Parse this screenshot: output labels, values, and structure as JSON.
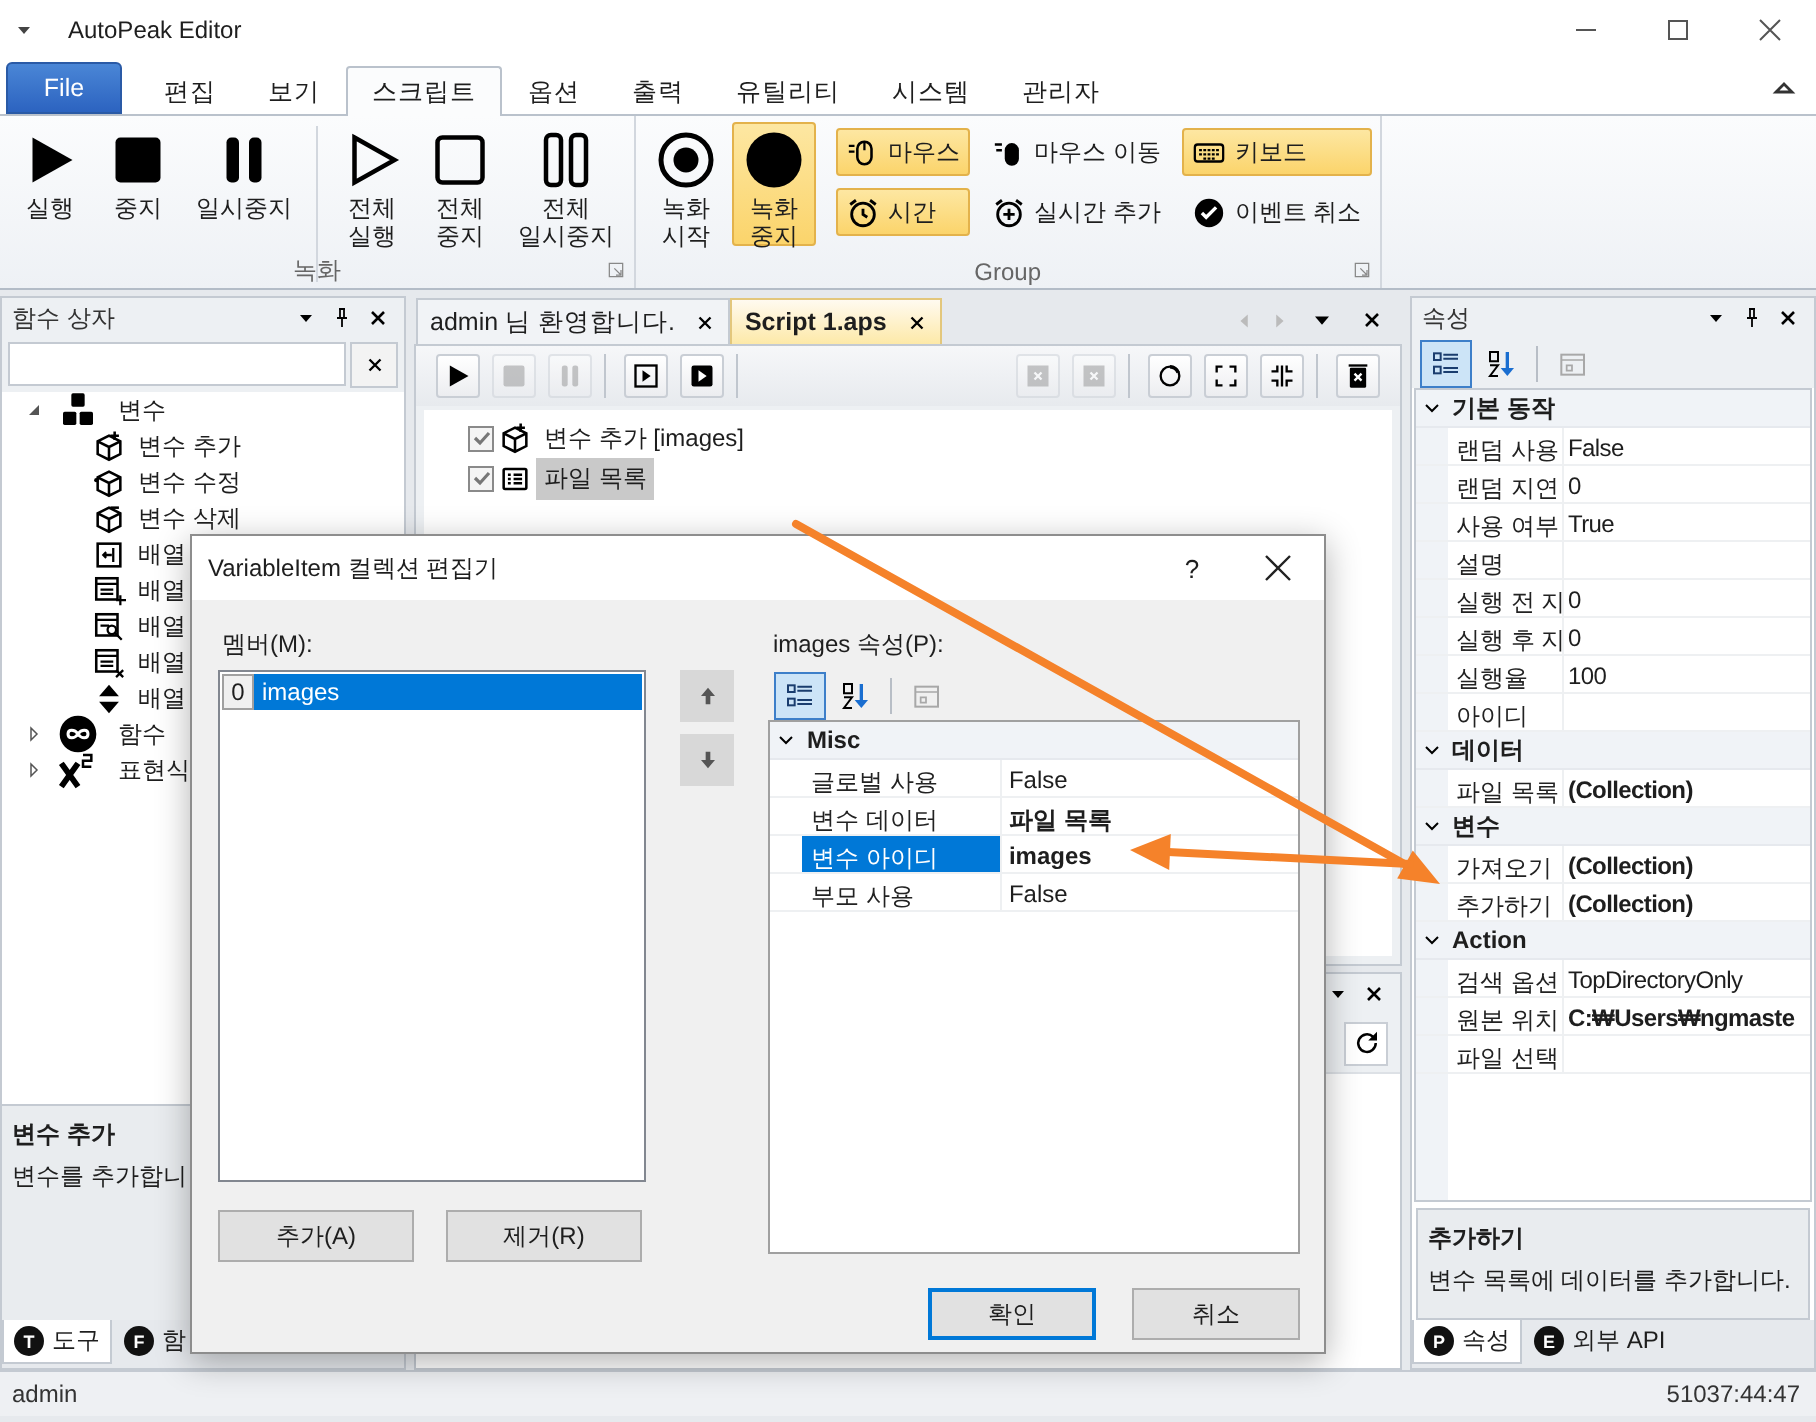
{
  "window": {
    "title": "AutoPeak Editor"
  },
  "ribbon": {
    "tabs": [
      {
        "label": "File",
        "kind": "file",
        "selected": false
      },
      {
        "label": "편집",
        "kind": "tab",
        "selected": false
      },
      {
        "label": "보기",
        "kind": "tab",
        "selected": false
      },
      {
        "label": "스크립트",
        "kind": "tab",
        "selected": true
      },
      {
        "label": "옵션",
        "kind": "tab",
        "selected": false
      },
      {
        "label": "출력",
        "kind": "tab",
        "selected": false
      },
      {
        "label": "유틸리티",
        "kind": "tab",
        "selected": false
      },
      {
        "label": "시스템",
        "kind": "tab",
        "selected": false
      },
      {
        "label": "관리자",
        "kind": "tab",
        "selected": false
      }
    ],
    "groups": [
      {
        "label": "녹화",
        "button_sets": [
          [
            {
              "label": "실행",
              "kind": "play",
              "active": false
            },
            {
              "label": "중지",
              "kind": "stop",
              "active": false
            },
            {
              "label": "일시중지",
              "kind": "pause",
              "active": false
            }
          ],
          [
            {
              "label": "전체 실행",
              "kind": "play-outline",
              "active": false
            },
            {
              "label": "전체 중지",
              "kind": "stop-outline",
              "active": false
            },
            {
              "label": "전체 일시중지",
              "kind": "pause-outline",
              "active": false
            }
          ]
        ]
      },
      {
        "label": "Group",
        "button_sets": [
          [
            {
              "label": "녹화 시작",
              "kind": "record",
              "active": false
            },
            {
              "label": "녹화 중지",
              "kind": "dot",
              "active": true
            }
          ]
        ],
        "small_buttons": [
          {
            "label": "마우스",
            "kind": "mouse",
            "active": true
          },
          {
            "label": "마우스 이동",
            "kind": "mouse-move",
            "active": false
          },
          {
            "label": "키보드",
            "kind": "keyboard",
            "active": true
          },
          {
            "label": "시간",
            "kind": "alarm",
            "active": true
          },
          {
            "label": "실시간 추가",
            "kind": "alarm-add",
            "active": false
          },
          {
            "label": "이벤트 취소",
            "kind": "check",
            "active": false
          }
        ]
      }
    ]
  },
  "function_box": {
    "title": "함수 상자",
    "tree": [
      {
        "label": "변수",
        "kind": "blocks",
        "expanded": true,
        "children": [
          {
            "label": "변수 추가",
            "kind": "box-add"
          },
          {
            "label": "변수 수정",
            "kind": "box-edit"
          },
          {
            "label": "변수 삭제",
            "kind": "box-remove"
          },
          {
            "label": "배열",
            "kind": "table-insert"
          },
          {
            "label": "배열",
            "kind": "table-add"
          },
          {
            "label": "배열",
            "kind": "table-search"
          },
          {
            "label": "배열",
            "kind": "table-remove"
          },
          {
            "label": "배열",
            "kind": "sort"
          }
        ]
      },
      {
        "label": "함수",
        "kind": "infinity",
        "expanded": false
      },
      {
        "label": "표현식",
        "kind": "x-squared",
        "expanded": false
      }
    ],
    "description": {
      "title": "변수 추가",
      "text": "변수를 추가합니"
    },
    "tabs": [
      {
        "badge": "T",
        "label": "도구",
        "selected": true
      },
      {
        "badge": "F",
        "label": "함",
        "selected": false
      }
    ]
  },
  "document": {
    "tabs": [
      {
        "label": "admin 님 환영합니다.",
        "selected": false
      },
      {
        "label": "Script 1.aps",
        "selected": true
      }
    ],
    "toolbar_left": [
      [
        {
          "kind": "play",
          "disabled": false
        },
        {
          "kind": "stop",
          "disabled": true
        },
        {
          "kind": "pause",
          "disabled": true
        }
      ],
      [
        {
          "kind": "play-frame",
          "disabled": false
        },
        {
          "kind": "play-box",
          "disabled": false
        }
      ]
    ],
    "toolbar_right": [
      [
        {
          "kind": "x-box",
          "disabled": true
        },
        {
          "kind": "x-box",
          "disabled": true
        }
      ],
      [
        {
          "kind": "circle",
          "disabled": false
        },
        {
          "kind": "expand",
          "disabled": false
        },
        {
          "kind": "collapse",
          "disabled": false
        }
      ],
      [
        {
          "kind": "delete",
          "disabled": false
        }
      ]
    ],
    "steps": [
      {
        "label": "변수 추가 [images]",
        "kind": "box-add",
        "checked": true,
        "selected": false
      },
      {
        "label": "파일 목록",
        "kind": "list",
        "checked": true,
        "selected": true
      }
    ],
    "lower_toolbar": [
      {
        "kind": "refresh",
        "disabled": false
      }
    ]
  },
  "properties": {
    "title": "속성",
    "toolbar": [
      {
        "kind": "categorized",
        "selected": true,
        "disabled": false
      },
      {
        "kind": "alphabetical",
        "selected": false,
        "disabled": false
      },
      {
        "kind": "pages",
        "selected": false,
        "disabled": true
      }
    ],
    "categories": [
      {
        "name": "기본 동작",
        "expanded": true,
        "rows": [
          {
            "name": "랜덤 사용",
            "value": "False",
            "bold": false
          },
          {
            "name": "랜덤 지연",
            "value": "0",
            "bold": false
          },
          {
            "name": "사용 여부",
            "value": "True",
            "bold": false
          },
          {
            "name": "설명"
          },
          {
            "name": "실행 전 지",
            "value": "0",
            "bold": false
          },
          {
            "name": "실행 후 지",
            "value": "0",
            "bold": false
          },
          {
            "name": "실행율",
            "value": "100",
            "bold": false
          },
          {
            "name": "아이디"
          }
        ]
      },
      {
        "name": "데이터",
        "expanded": true,
        "rows": [
          {
            "name": "파일 목록",
            "value": "(Collection)",
            "bold": true
          }
        ]
      },
      {
        "name": "변수",
        "expanded": true,
        "rows": [
          {
            "name": "가져오기",
            "value": "(Collection)",
            "bold": true
          },
          {
            "name": "추가하기",
            "value": "(Collection)",
            "bold": true
          }
        ]
      },
      {
        "name": "Action",
        "expanded": true,
        "rows": [
          {
            "name": "검색 옵션",
            "value": "TopDirectoryOnly",
            "bold": false
          },
          {
            "name": "원본 위치",
            "value": "C:₩Users₩ngmaste",
            "bold": true
          },
          {
            "name": "파일 선택"
          }
        ]
      }
    ],
    "description": {
      "title": "추가하기",
      "text": "변수 목록에 데이터를 추가합니다."
    },
    "tabs": [
      {
        "badge": "P",
        "label": "속성",
        "selected": true
      },
      {
        "badge": "E",
        "label": "외부 API",
        "selected": false
      }
    ]
  },
  "dialog": {
    "title": "VariableItem 컬렉션 편집기",
    "help": "?",
    "members_label": "멤버(M):",
    "members": [
      {
        "index": "0",
        "name": "images",
        "selected": true
      }
    ],
    "move_buttons": [
      {
        "kind": "up"
      },
      {
        "kind": "down"
      }
    ],
    "member_buttons": [
      {
        "label": "추가(A)"
      },
      {
        "label": "제거(R)"
      }
    ],
    "properties_label": "images 속성(P):",
    "toolbar": [
      {
        "kind": "categorized",
        "selected": true,
        "disabled": false
      },
      {
        "kind": "alphabetical",
        "selected": false,
        "disabled": false
      },
      {
        "kind": "pages",
        "selected": false,
        "disabled": true
      }
    ],
    "categories": [
      {
        "name": "Misc",
        "expanded": true,
        "rows": [
          {
            "name": "글로벌 사용",
            "value": "False",
            "bold": false,
            "selected": false
          },
          {
            "name": "변수 데이터",
            "value": "파일 목록",
            "bold": true,
            "selected": false
          },
          {
            "name": "변수 아이디",
            "value": "images",
            "bold": true,
            "selected": true
          },
          {
            "name": "부모 사용",
            "value": "False",
            "bold": false,
            "selected": false
          }
        ]
      }
    ],
    "buttons": [
      {
        "label": "확인",
        "default": true
      },
      {
        "label": "취소",
        "default": false
      }
    ]
  },
  "status_bar": {
    "user": "admin",
    "time": "51037:44:47"
  }
}
